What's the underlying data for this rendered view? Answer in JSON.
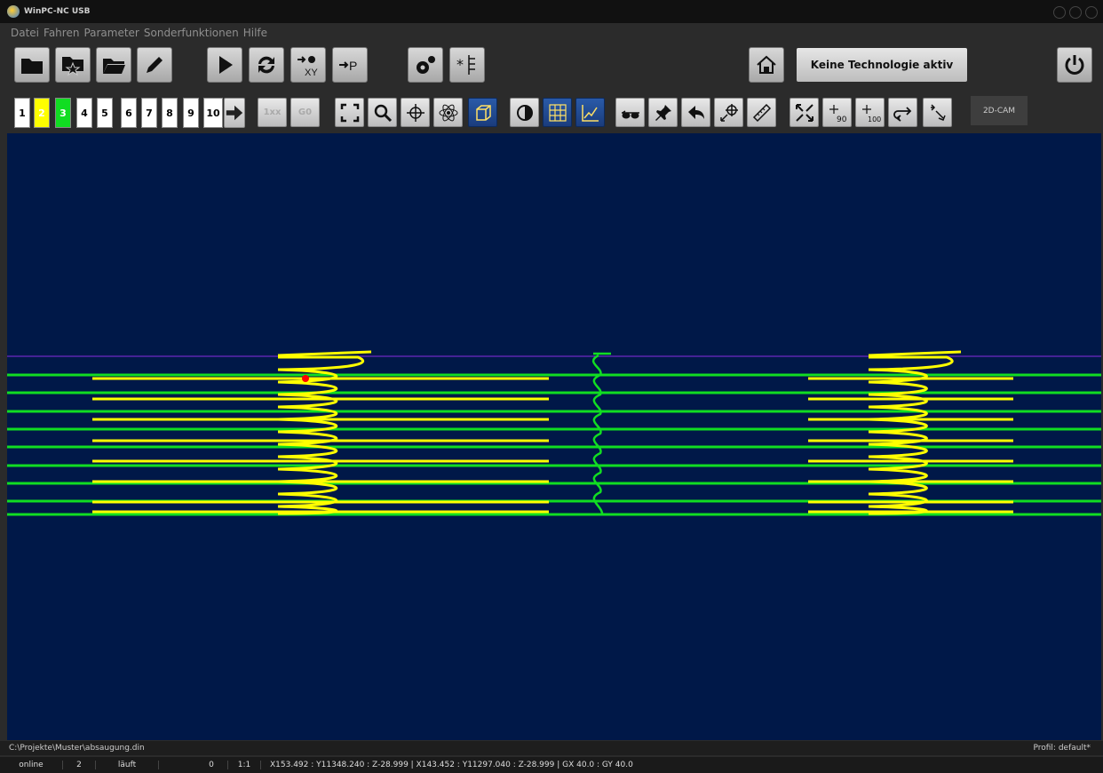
{
  "window": {
    "title": "WinPC-NC USB"
  },
  "menu": [
    "Datei",
    "Fahren",
    "Parameter",
    "Sonderfunktionen",
    "Hilfe"
  ],
  "toolbar1": {
    "technology_label": "Keine Technologie aktiv"
  },
  "toolbar2": {
    "numbers": [
      "1",
      "2",
      "3",
      "4",
      "5",
      "6",
      "7",
      "8",
      "9",
      "10"
    ],
    "rel_label": "1xx",
    "g0_label": "G0",
    "cam_label": "2D-CAM"
  },
  "status": {
    "file_path": "C:\\Projekte\\Muster\\absaugung.din",
    "profile": "Profil: default*",
    "connection": "online",
    "count": "2",
    "state": "läuft",
    "zero": "0",
    "scale": "1:1",
    "coords": "X153.492 : Y11348.240  : Z-28.999 | X143.452 : Y11297.040 : Z-28.999  |  GX 40.0 : GY 40.0"
  },
  "colors": {
    "canvas_bg": "#001848",
    "path_green": "#11dd22",
    "path_yellow": "#ffff00",
    "boundary_purple": "#8a2be2",
    "tool_marker": "#ff0000"
  }
}
